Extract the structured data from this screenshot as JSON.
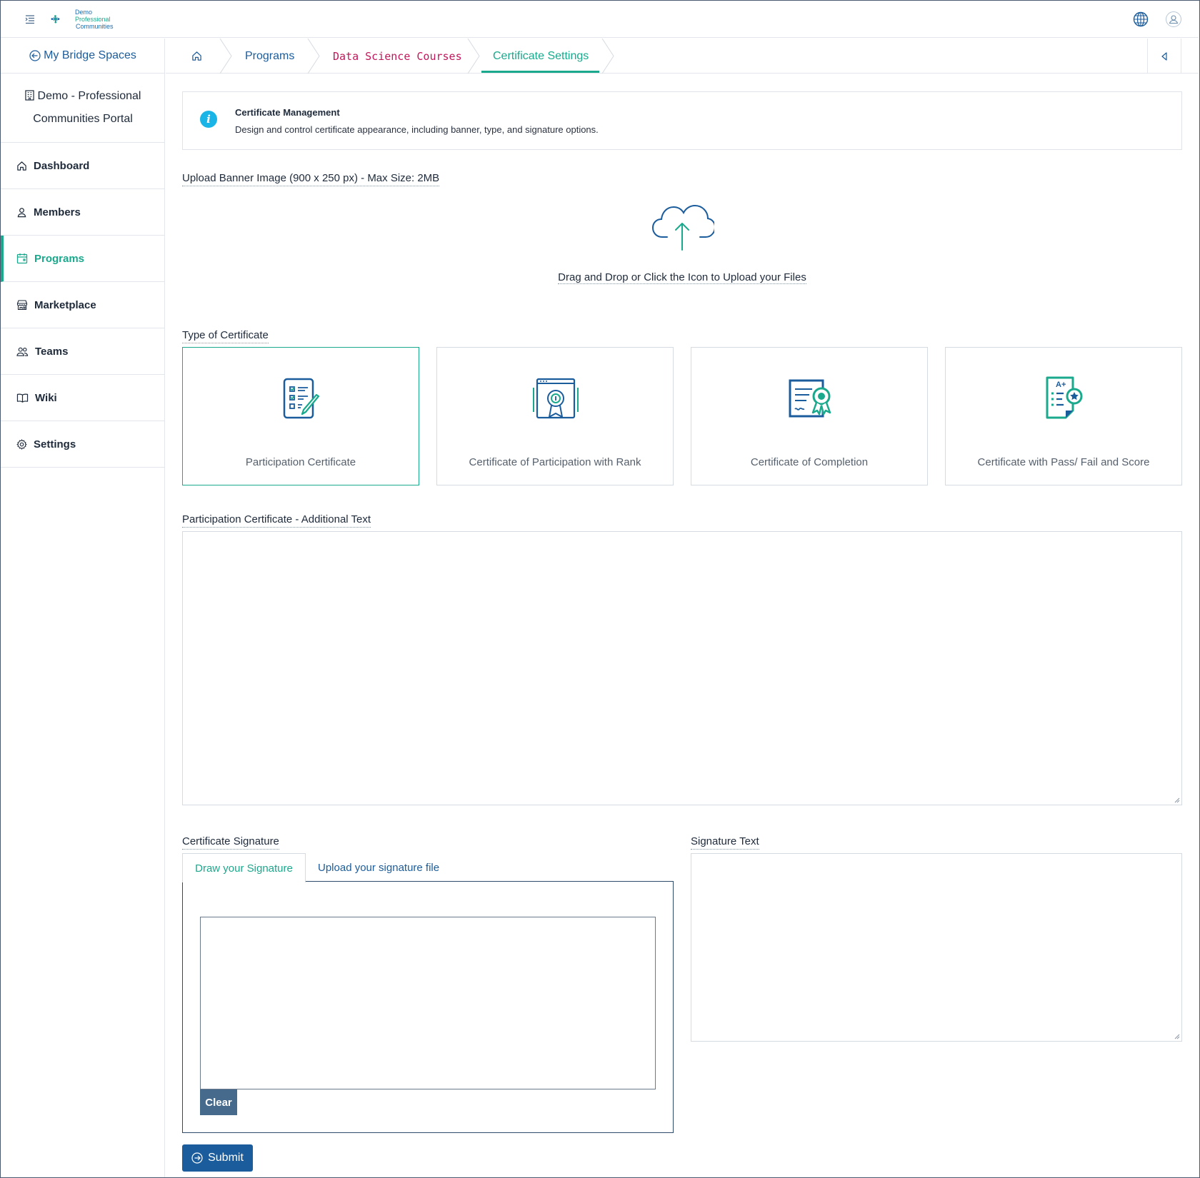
{
  "header": {
    "logo_lines": [
      "Demo",
      "Professional",
      "Communities"
    ]
  },
  "sidebar": {
    "back_label": "My Bridge Spaces",
    "org_line1": "Demo - Professional",
    "org_line2": "Communities Portal",
    "items": [
      {
        "label": "Dashboard",
        "icon": "home-icon"
      },
      {
        "label": "Members",
        "icon": "person-icon"
      },
      {
        "label": "Programs",
        "icon": "calendar-icon",
        "active": true
      },
      {
        "label": "Marketplace",
        "icon": "store-icon"
      },
      {
        "label": "Teams",
        "icon": "people-icon"
      },
      {
        "label": "Wiki",
        "icon": "book-icon"
      },
      {
        "label": "Settings",
        "icon": "gear-icon"
      }
    ]
  },
  "breadcrumb": {
    "items": [
      "Programs",
      "Data Science Courses",
      "Certificate Settings"
    ]
  },
  "info": {
    "title": "Certificate Management",
    "description": "Design and control certificate appearance, including banner, type, and signature options."
  },
  "banner": {
    "label": "Upload Banner Image (900 x 250 px) - Max Size: 2MB",
    "upload_text": "Drag and Drop or Click the Icon to Upload your Files"
  },
  "certificate_type": {
    "label": "Type of Certificate",
    "options": [
      {
        "label": "Participation Certificate",
        "icon": "checklist-pencil-icon",
        "selected": true
      },
      {
        "label": "Certificate of Participation with Rank",
        "icon": "rank-badge-icon"
      },
      {
        "label": "Certificate of Completion",
        "icon": "certificate-ribbon-icon"
      },
      {
        "label": "Certificate with Pass/ Fail and Score",
        "icon": "grade-report-icon"
      }
    ]
  },
  "additional_text": {
    "label": "Participation Certificate - Additional Text",
    "value": ""
  },
  "signature": {
    "label": "Certificate Signature",
    "tab_draw": "Draw your Signature",
    "tab_upload": "Upload your signature file",
    "clear_label": "Clear",
    "text_label": "Signature Text",
    "text_value": ""
  },
  "submit_label": "Submit",
  "colors": {
    "accent": "#1aa98c",
    "primary": "#1b5c9c",
    "breadcrumb_course": "#c2185b",
    "info": "#1ab4e6"
  }
}
